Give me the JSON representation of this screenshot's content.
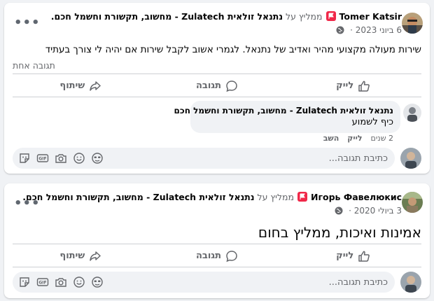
{
  "posts": [
    {
      "author": "Tomer Katsir",
      "recommends_text": "ממליץ על",
      "page_name": "נתנאל זולאית Zulatech - מחשוב, תקשורת וחשמל חכם.",
      "date": "6 ביוני 2023",
      "text": "שירות מעולה מקצועי מהיר ואדיב של נתנאל. לגמרי אשוב לקבל שירות אם יהיה לי צורך בעתיד",
      "comments_count": "תגובה אחת",
      "actions": {
        "like": "לייק",
        "comment": "תגובה",
        "share": "שיתוף"
      },
      "comment": {
        "author": "נתנאל זולאית Zulatech - מחשוב, תקשורת וחשמל חכם",
        "text": "כיף לשמוע",
        "age": "2 שנים",
        "like": "לייק",
        "reply": "השב"
      },
      "input_placeholder": "כתיבת תגובה..."
    },
    {
      "author": "Игорь Фавелюкис",
      "recommends_text": "ממליץ על",
      "page_name": "נתנאל זולאית Zulatech - מחשוב, תקשורת וחשמל חכם.",
      "date": "3 ביולי 2020",
      "text": "אמינות ואיכות, ממליץ בחום",
      "actions": {
        "like": "לייק",
        "comment": "תגובה",
        "share": "שיתוף"
      },
      "input_placeholder": "כתיבת תגובה..."
    }
  ],
  "icons": {
    "more": "more-options-icon",
    "recommend": "recommend-flag-icon",
    "privacy": "globe-icon",
    "like": "thumbs-up-icon",
    "comment": "comment-bubble-icon",
    "share": "share-arrow-icon",
    "composer": [
      "sticker-icon",
      "gif-icon",
      "camera-icon",
      "emoji-icon",
      "avatar-sticker-icon"
    ]
  },
  "colors": {
    "recommend": "#f02849",
    "muted": "#65676b",
    "background": "#f0f2f5"
  }
}
